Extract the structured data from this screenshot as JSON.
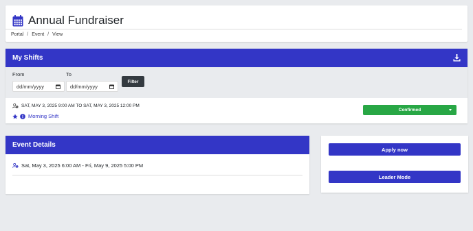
{
  "header": {
    "title": "Annual Fundraiser",
    "breadcrumb": [
      "Portal",
      "Event",
      "View"
    ]
  },
  "shifts": {
    "title": "My Shifts",
    "filter": {
      "from_label": "From",
      "to_label": "To",
      "from_placeholder": "dd/mm/yyyy",
      "to_placeholder": "dd/mm/yyyy",
      "button": "Filter"
    },
    "rows": [
      {
        "time": "SAT, MAY 3, 2025 9:00 AM TO SAT, MAY 3, 2025 12:00 PM",
        "name": "Morning Shift",
        "status": "Confirmed"
      }
    ]
  },
  "event_details": {
    "title": "Event Details",
    "date_range": "Sat, May 3, 2025 6:00 AM - Fri, May 9, 2025 5:00 PM"
  },
  "actions": {
    "apply": "Apply now",
    "leader": "Leader Mode"
  },
  "colors": {
    "primary": "#3336c6",
    "success": "#28a745",
    "dark": "#343a40",
    "background": "#e9ebee"
  }
}
